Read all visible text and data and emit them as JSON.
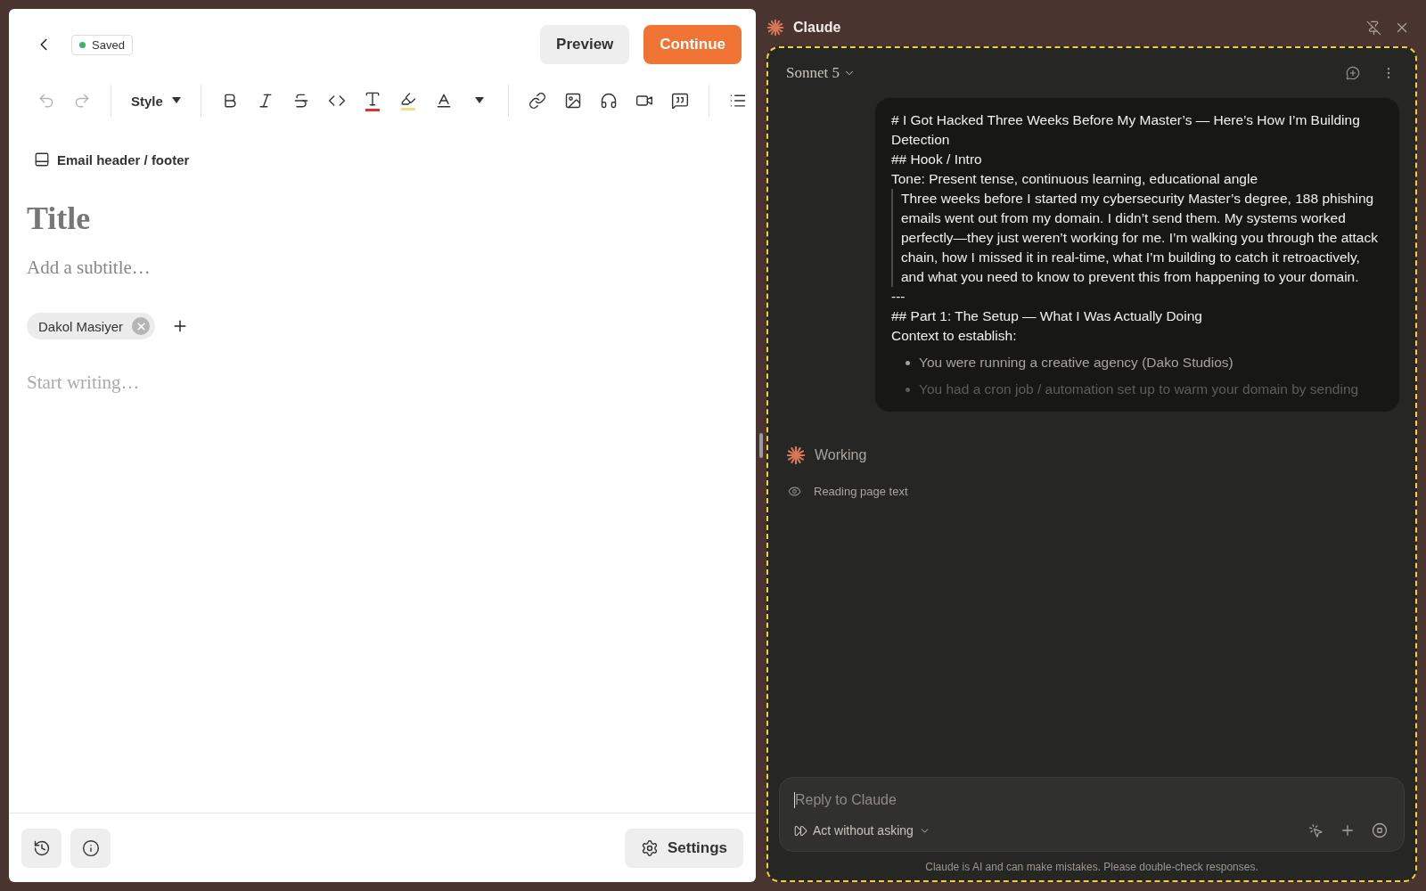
{
  "editor": {
    "header": {
      "status": "Saved",
      "preview": "Preview",
      "continue": "Continue"
    },
    "toolbar": {
      "undo": {
        "disabled": true
      },
      "redo": {
        "disabled": true
      },
      "style": "Style"
    },
    "email_header": "Email header / footer",
    "title_placeholder": "Title",
    "subtitle_placeholder": "Add a subtitle…",
    "authors": [
      {
        "name": "Dakol Masiyer"
      }
    ],
    "body_placeholder": "Start writing…",
    "footer": {
      "settings": "Settings"
    }
  },
  "assistant": {
    "title": "Claude",
    "model": "Sonnet 5",
    "message": [
      {
        "kind": "line",
        "text": "# I Got Hacked Three Weeks Before My Master’s — Here’s How I’m Building Detection"
      },
      {
        "kind": "line",
        "text": "## Hook / Intro"
      },
      {
        "kind": "line",
        "text": "Tone: Present tense, continuous learning, educational angle"
      },
      {
        "kind": "quote",
        "text": "Three weeks before I started my cybersecurity Master’s degree, 188 phishing emails went out from my domain. I didn’t send them. My systems worked perfectly—they just weren’t working for me. I’m walking you through the attack chain, how I missed it in real-time, what I’m building to catch it retroactively, and what you need to know to prevent this from happening to your domain."
      },
      {
        "kind": "line",
        "text": "---"
      },
      {
        "kind": "line",
        "text": "## Part 1: The Setup — What I Was Actually Doing"
      },
      {
        "kind": "line",
        "text": "Context to establish:"
      },
      {
        "kind": "bullet",
        "text": "You were running a creative agency (Dako Studios)"
      },
      {
        "kind": "bullet",
        "text": "You had a cron job / automation set up to warm your domain by sending"
      }
    ],
    "status": "Working",
    "step": "Reading page text",
    "input_placeholder": "Reply to Claude",
    "mode": "Act without asking",
    "disclaimer": "Claude is AI and can make mistakes. Please double-check responses."
  }
}
